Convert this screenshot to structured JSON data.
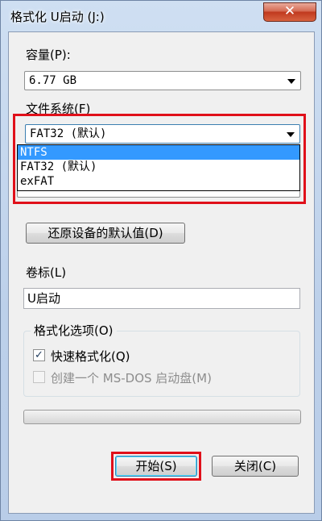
{
  "window": {
    "title": "格式化 U启动 (J:)",
    "close_glyph": "✕",
    "close_icon": "close-icon"
  },
  "capacity": {
    "label": "容量(P):",
    "value": "6.77 GB"
  },
  "filesystem": {
    "label": "文件系统(F)",
    "value": "FAT32 (默认)",
    "options": [
      "NTFS",
      "FAT32 (默认)",
      "exFAT"
    ],
    "highlighted_index": 0
  },
  "restore_defaults_label": "还原设备的默认值(D)",
  "volume": {
    "label": "卷标(L)",
    "value": "U启动"
  },
  "format_options": {
    "title": "格式化选项(O)",
    "quick_format": {
      "label": "快速格式化(Q)",
      "checked": true,
      "check_glyph": "✓"
    },
    "msdos_disk": {
      "label": "创建一个 MS-DOS 启动盘(M)",
      "checked": false,
      "disabled": true
    }
  },
  "progress": {
    "value": 0
  },
  "buttons": {
    "start": "开始(S)",
    "close": "关闭(C)"
  },
  "colors": {
    "highlight_red": "#e0101a",
    "selection_blue": "#3399ff"
  }
}
